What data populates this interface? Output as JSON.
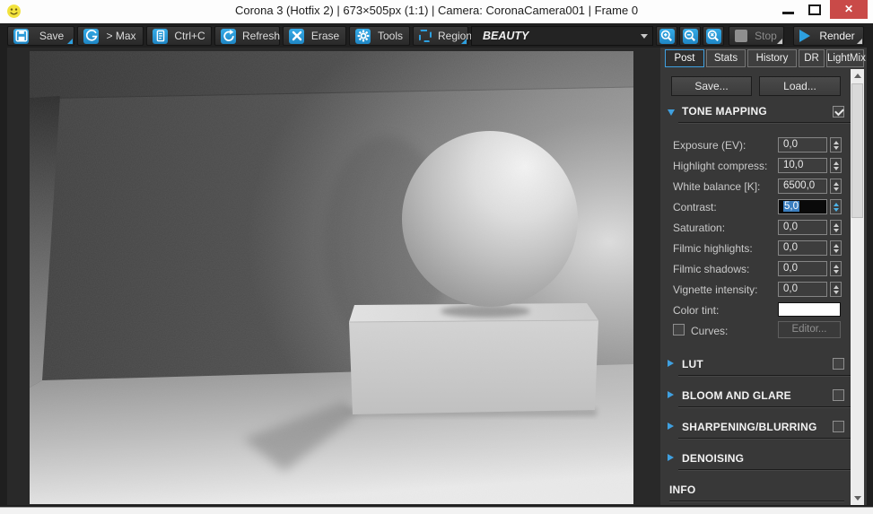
{
  "window": {
    "title": "Corona 3 (Hotfix 2) | 673×505px (1:1) | Camera: CoronaCamera001 | Frame 0",
    "minimize_glyph": "–",
    "close_glyph": "✕"
  },
  "toolbar": {
    "save": "Save",
    "max": "> Max",
    "copy": "Ctrl+C",
    "refresh": "Refresh",
    "erase": "Erase",
    "tools": "Tools",
    "region": "Region",
    "channel": "BEAUTY",
    "stop": "Stop",
    "render": "Render"
  },
  "panel": {
    "tabs": [
      "Post",
      "Stats",
      "History",
      "DR",
      "LightMix"
    ],
    "active_tab": "Post",
    "save_button": "Save...",
    "load_button": "Load...",
    "tone_mapping": {
      "title": "TONE MAPPING",
      "enabled": true,
      "rows": [
        {
          "label": "Exposure (EV):",
          "value": "0,0"
        },
        {
          "label": "Highlight compress:",
          "value": "10,0"
        },
        {
          "label": "White balance [K]:",
          "value": "6500,0"
        },
        {
          "label": "Contrast:",
          "value": "5,0",
          "selected": true
        },
        {
          "label": "Saturation:",
          "value": "0,0"
        },
        {
          "label": "Filmic highlights:",
          "value": "0,0"
        },
        {
          "label": "Filmic shadows:",
          "value": "0,0"
        },
        {
          "label": "Vignette intensity:",
          "value": "0,0"
        }
      ],
      "color_tint_label": "Color tint:",
      "color_tint_value": "#ffffff",
      "curves_label": "Curves:",
      "curves_checked": false,
      "editor_button": "Editor..."
    },
    "sections": [
      {
        "label": "LUT",
        "has_checkbox": true
      },
      {
        "label": "BLOOM AND GLARE",
        "has_checkbox": true
      },
      {
        "label": "SHARPENING/BLURRING",
        "has_checkbox": true
      },
      {
        "label": "DENOISING",
        "has_checkbox": false
      }
    ],
    "info_label": "INFO"
  },
  "render_scene": {
    "channel": "BEAUTY",
    "description": "Grayscale render preview: white sphere resting on a white box inside a gray room, lit from the right"
  },
  "colors": {
    "accent_blue": "#2da0e0",
    "selection_blue": "#3a7ebf",
    "close_red": "#c94a48",
    "panel_bg": "#383838",
    "toolbar_bg": "#1f1f1f"
  }
}
